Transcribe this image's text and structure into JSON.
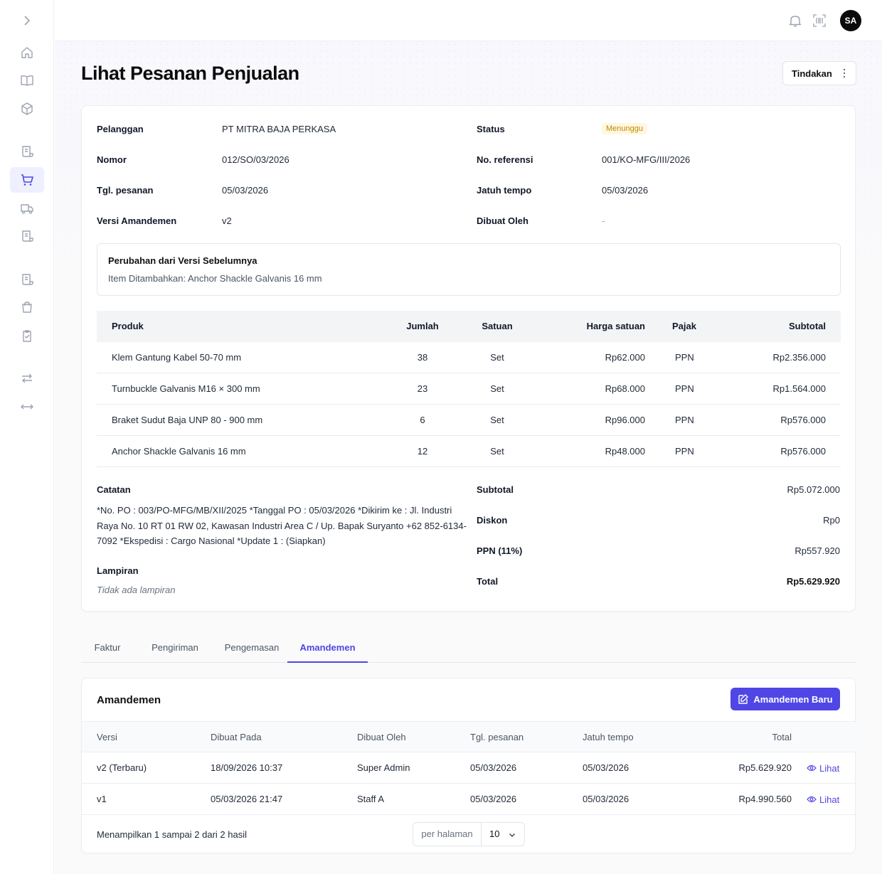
{
  "sidebar": {
    "icons": [
      "chevron-right-icon",
      "home-icon",
      "book-icon",
      "box-icon",
      "receipt-icon",
      "cart-icon",
      "truck-icon",
      "receipt-icon",
      "receipt-icon",
      "bag-icon",
      "clipboard-check-icon",
      "transfer-icon",
      "arrows-horizontal-icon"
    ],
    "active": "cart-icon"
  },
  "topbar": {
    "avatar_initials": "SA"
  },
  "header": {
    "title": "Lihat Pesanan Penjualan",
    "action_label": "Tindakan"
  },
  "order": {
    "customer_label": "Pelanggan",
    "customer": "PT MITRA BAJA PERKASA",
    "number_label": "Nomor",
    "number": "012/SO/03/2026",
    "order_date_label": "Tgl. pesanan",
    "order_date": "05/03/2026",
    "version_label": "Versi Amandemen",
    "version": "v2",
    "status_label": "Status",
    "status": "Menunggu",
    "reference_label": "No. referensi",
    "reference": "001/KO-MFG/III/2026",
    "due_label": "Jatuh tempo",
    "due": "05/03/2026",
    "created_by_label": "Dibuat Oleh",
    "created_by": "-"
  },
  "changes": {
    "title": "Perubahan dari Versi Sebelumnya",
    "detail": "Item Ditambahkan: Anchor Shackle Galvanis 16 mm"
  },
  "products": {
    "headers": {
      "product": "Produk",
      "qty": "Jumlah",
      "unit": "Satuan",
      "price": "Harga satuan",
      "tax": "Pajak",
      "subtotal": "Subtotal"
    },
    "rows": [
      {
        "product": "Klem Gantung Kabel 50-70 mm",
        "qty": "38",
        "unit": "Set",
        "price": "Rp62.000",
        "tax": "PPN",
        "subtotal": "Rp2.356.000"
      },
      {
        "product": "Turnbuckle Galvanis M16 × 300 mm",
        "qty": "23",
        "unit": "Set",
        "price": "Rp68.000",
        "tax": "PPN",
        "subtotal": "Rp1.564.000"
      },
      {
        "product": "Braket Sudut Baja UNP 80 - 900 mm",
        "qty": "6",
        "unit": "Set",
        "price": "Rp96.000",
        "tax": "PPN",
        "subtotal": "Rp576.000"
      },
      {
        "product": "Anchor Shackle Galvanis 16 mm",
        "qty": "12",
        "unit": "Set",
        "price": "Rp48.000",
        "tax": "PPN",
        "subtotal": "Rp576.000"
      }
    ]
  },
  "notes": {
    "label": "Catatan",
    "text": "*No. PO : 003/PO-MFG/MB/XII/2025 *Tanggal PO : 05/03/2026 *Dikirim ke : Jl. Industri Raya No. 10 RT 01 RW 02, Kawasan Industri Area C / Up. Bapak Suryanto +62 852-6134-7092 *Ekspedisi : Cargo Nasional *Update 1 : (Siapkan)",
    "attachment_label": "Lampiran",
    "attachment_empty": "Tidak ada lampiran"
  },
  "summary": {
    "subtotal_label": "Subtotal",
    "subtotal": "Rp5.072.000",
    "discount_label": "Diskon",
    "discount": "Rp0",
    "tax_label": "PPN (11%)",
    "tax": "Rp557.920",
    "total_label": "Total",
    "total": "Rp5.629.920"
  },
  "tabs": [
    {
      "label": "Faktur"
    },
    {
      "label": "Pengiriman"
    },
    {
      "label": "Pengemasan"
    },
    {
      "label": "Amandemen",
      "active": true
    }
  ],
  "amendments": {
    "title": "Amandemen",
    "new_button": "Amandemen Baru",
    "headers": {
      "version": "Versi",
      "created_at": "Dibuat Pada",
      "created_by": "Dibuat Oleh",
      "order_date": "Tgl. pesanan",
      "due": "Jatuh tempo",
      "total": "Total"
    },
    "rows": [
      {
        "version": "v2 (Terbaru)",
        "created_at": "18/09/2026 10:37",
        "created_by": "Super Admin",
        "order_date": "05/03/2026",
        "due": "05/03/2026",
        "total": "Rp5.629.920",
        "action": "Lihat"
      },
      {
        "version": "v1",
        "created_at": "05/03/2026 21:47",
        "created_by": "Staff A",
        "order_date": "05/03/2026",
        "due": "05/03/2026",
        "total": "Rp4.990.560",
        "action": "Lihat"
      }
    ],
    "footer_text": "Menampilkan 1 sampai 2 dari 2 hasil",
    "per_page_label": "per halaman",
    "per_page_value": "10"
  },
  "colors": {
    "accent": "#4f46e5",
    "badge_text": "#c28a00",
    "badge_bg": "#fff7e0"
  }
}
